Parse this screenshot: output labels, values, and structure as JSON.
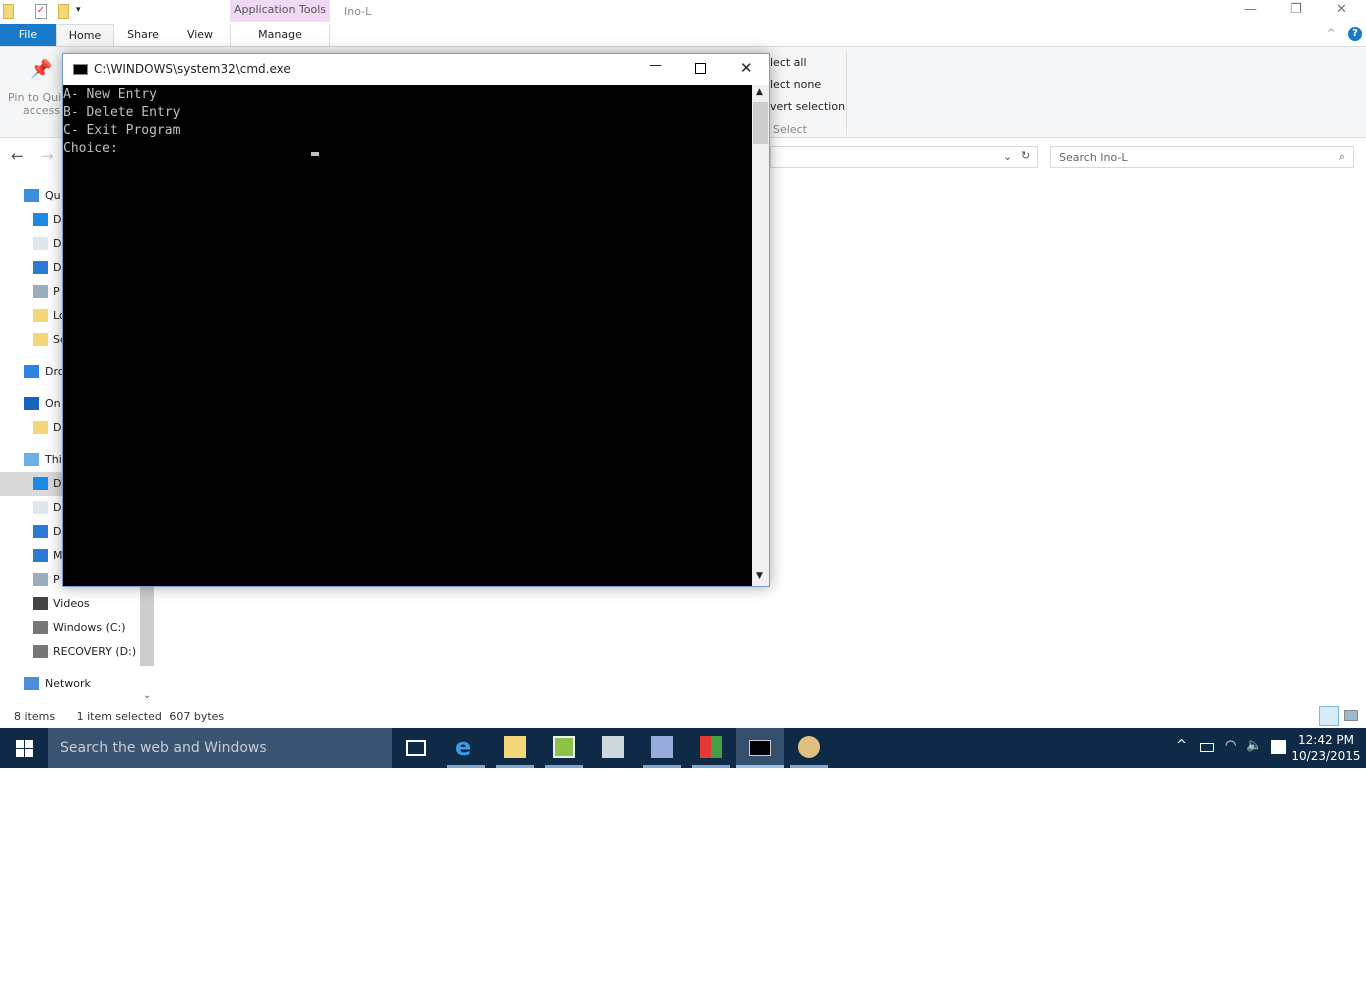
{
  "explorer": {
    "title": "Ino-L",
    "tabs": {
      "file": "File",
      "home": "Home",
      "share": "Share",
      "view": "View",
      "contextual": "Application Tools",
      "manage": "Manage"
    },
    "ribbon": {
      "pin_line1": "Pin to Qui",
      "pin_line2": "access",
      "select_all": "lect all",
      "select_none": "lect none",
      "invert": "vert selection",
      "group": "Select"
    },
    "search_placeholder": "Search Ino-L",
    "nav": [
      {
        "label": "Qu",
        "icon": "star-icon",
        "level": 1
      },
      {
        "label": "D",
        "icon": "desktop-icon"
      },
      {
        "label": "D",
        "icon": "documents-icon"
      },
      {
        "label": "D",
        "icon": "downloads-icon"
      },
      {
        "label": "P",
        "icon": "pictures-icon"
      },
      {
        "label": "Lo",
        "icon": "folder-icon"
      },
      {
        "label": "Sc",
        "icon": "folder-icon"
      },
      {
        "label": "Drc",
        "icon": "dropbox-icon",
        "level": 1
      },
      {
        "label": "On",
        "icon": "onedrive-icon",
        "level": 1
      },
      {
        "label": "D",
        "icon": "folder-icon"
      },
      {
        "label": "Thi",
        "icon": "this-pc-icon",
        "level": 1
      },
      {
        "label": "D",
        "icon": "desktop-icon",
        "selected": true
      },
      {
        "label": "D",
        "icon": "documents-icon"
      },
      {
        "label": "D",
        "icon": "downloads-icon"
      },
      {
        "label": "M",
        "icon": "music-icon"
      },
      {
        "label": "P",
        "icon": "pictures-icon"
      },
      {
        "label": "Videos",
        "icon": "videos-icon"
      },
      {
        "label": "Windows (C:)",
        "icon": "drive-icon"
      },
      {
        "label": "RECOVERY (D:)",
        "icon": "drive-icon"
      },
      {
        "label": "Network",
        "icon": "network-icon",
        "level": 1
      }
    ],
    "status": {
      "items": "8 items",
      "selected": "1 item selected",
      "size": "607 bytes"
    }
  },
  "cmd": {
    "title": "C:\\WINDOWS\\system32\\cmd.exe",
    "lines": [
      "A- New Entry",
      "B- Delete Entry",
      "C- Exit Program",
      "Choice:"
    ]
  },
  "taskbar": {
    "search": "Search the web and Windows",
    "time": "12:42 PM",
    "date": "10/23/2015"
  },
  "colors": {
    "accent": "#1979ca",
    "taskbar": "#0f2a46",
    "console_bg": "#000000"
  }
}
